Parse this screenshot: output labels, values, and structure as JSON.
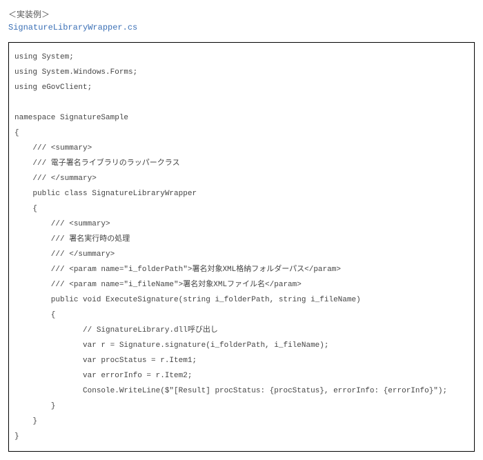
{
  "header": {
    "title": "＜実装例＞",
    "filename": "SignatureLibraryWrapper.cs"
  },
  "code": {
    "lines": [
      "using System;",
      "using System.Windows.Forms;",
      "using eGovClient;",
      "",
      "namespace SignatureSample",
      "{",
      "    /// <summary>",
      "    /// 電子署名ライブラリのラッパークラス",
      "    /// </summary>",
      "    public class SignatureLibraryWrapper",
      "    {",
      "        /// <summary>",
      "        /// 署名実行時の処理",
      "        /// </summary>",
      "        /// <param name=\"i_folderPath\">署名対象XML格納フォルダーパス</param>",
      "        /// <param name=\"i_fileName\">署名対象XMLファイル名</param>",
      "        public void ExecuteSignature(string i_folderPath, string i_fileName)",
      "        {",
      "               // SignatureLibrary.dll呼び出し",
      "               var r = Signature.signature(i_folderPath, i_fileName);",
      "               var procStatus = r.Item1;",
      "               var errorInfo = r.Item2;",
      "               Console.WriteLine($\"[Result] procStatus: {procStatus}, errorInfo: {errorInfo}\");",
      "        }",
      "    }",
      "}"
    ]
  }
}
